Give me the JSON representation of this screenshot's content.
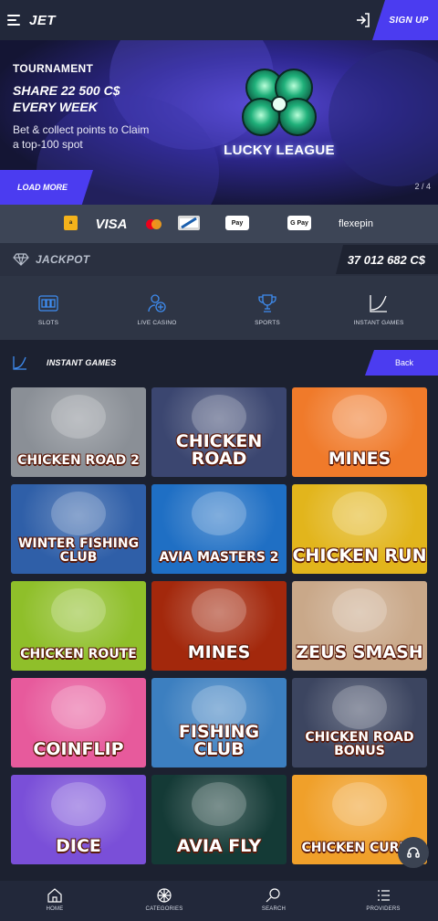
{
  "header": {
    "logo": "JET",
    "signup_label": "SIGN UP"
  },
  "banner": {
    "label": "TOURNAMENT",
    "title": "SHARE 22 500 C$ EVERY WEEK",
    "description": "Bet & collect points to Claim a top-100 spot",
    "promo_name": "LUCKY LEAGUE",
    "load_more_label": "LOAD MORE",
    "slide_counter": "2 / 4"
  },
  "payments": {
    "visa": "VISA",
    "apple_pay": "Pay",
    "google_pay": "G Pay",
    "flexepin": "flexepin"
  },
  "jackpot": {
    "label": "JACKPOT",
    "value": "37 012 682 C$"
  },
  "categories": [
    {
      "label": "SLOTS",
      "icon": "slots-icon"
    },
    {
      "label": "LIVE CASINO",
      "icon": "live-casino-icon"
    },
    {
      "label": "SPORTS",
      "icon": "sports-trophy-icon"
    },
    {
      "label": "INSTANT GAMES",
      "icon": "instant-games-icon"
    }
  ],
  "section": {
    "title": "INSTANT GAMES",
    "back_label": "Back"
  },
  "games": [
    {
      "title": "CHICKEN ROAD 2",
      "bg": "#8a8f96"
    },
    {
      "title": "CHICKEN ROAD",
      "bg": "#3b4670"
    },
    {
      "title": "MINES",
      "bg": "#f07a2a"
    },
    {
      "title": "WINTER FISHING CLUB",
      "bg": "#2f5fa8"
    },
    {
      "title": "AVIA MASTERS 2",
      "bg": "#1f6fc4"
    },
    {
      "title": "CHICKEN RUN",
      "bg": "#e2b51c"
    },
    {
      "title": "CHICKEN ROUTE",
      "bg": "#8fbf2a"
    },
    {
      "title": "MINES",
      "bg": "#a3280c"
    },
    {
      "title": "ZEUS SMASH",
      "bg": "#c9a889"
    },
    {
      "title": "COINFLIP",
      "bg": "#e75a9c"
    },
    {
      "title": "FISHING CLUB",
      "bg": "#3c7fc0"
    },
    {
      "title": "CHICKEN ROAD BONUS",
      "bg": "#3c4560"
    },
    {
      "title": "DICE",
      "bg": "#7a4fd8"
    },
    {
      "title": "AVIA FLY",
      "bg": "#143a36"
    },
    {
      "title": "CHICKEN CURRY",
      "bg": "#f0a02a"
    }
  ],
  "bottom_nav": [
    {
      "label": "HOME",
      "icon": "home-icon"
    },
    {
      "label": "CATEGORIES",
      "icon": "categories-icon"
    },
    {
      "label": "SEARCH",
      "icon": "search-icon"
    },
    {
      "label": "PROVIDERS",
      "icon": "providers-icon"
    }
  ],
  "colors": {
    "accent": "#4b3cf0",
    "background": "#1c2130",
    "header": "#22283a"
  }
}
